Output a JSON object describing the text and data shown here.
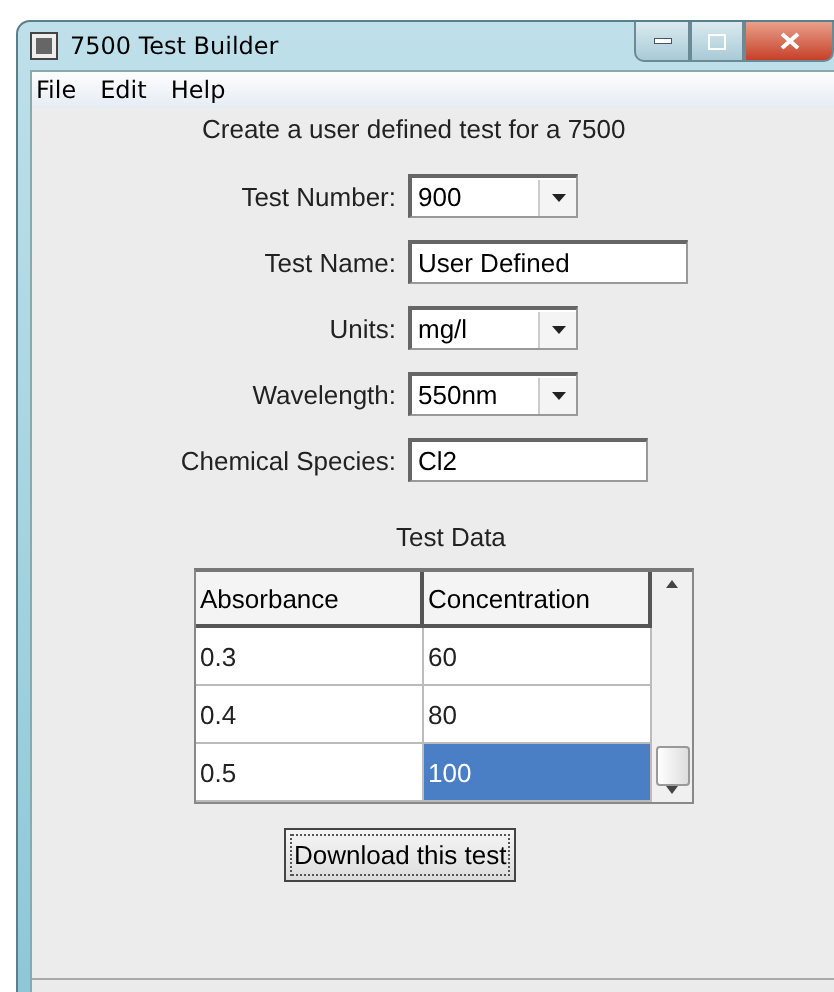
{
  "window": {
    "title": "7500 Test Builder"
  },
  "menu": [
    {
      "label": "File"
    },
    {
      "label": "Edit"
    },
    {
      "label": "Help"
    }
  ],
  "heading": "Create a user defined test for a 7500",
  "fields": [
    {
      "label": "Test Number:",
      "value": "900",
      "kind": "dropdown"
    },
    {
      "label": "Test Name:",
      "value": "User Defined",
      "kind": "text"
    },
    {
      "label": "Units:",
      "value": "mg/l",
      "kind": "dropdown"
    },
    {
      "label": "Wavelength:",
      "value": "550nm",
      "kind": "dropdown"
    },
    {
      "label": "Chemical Species:",
      "value": "Cl2",
      "kind": "text"
    }
  ],
  "test_data": {
    "title": "Test Data",
    "columns": [
      "Absorbance",
      "Concentration"
    ],
    "rows": [
      {
        "absorbance": "0.3",
        "concentration": "60",
        "selected": false
      },
      {
        "absorbance": "0.4",
        "concentration": "80",
        "selected": false
      },
      {
        "absorbance": "0.5",
        "concentration": "100",
        "selected": true
      }
    ]
  },
  "button": "Download this test"
}
